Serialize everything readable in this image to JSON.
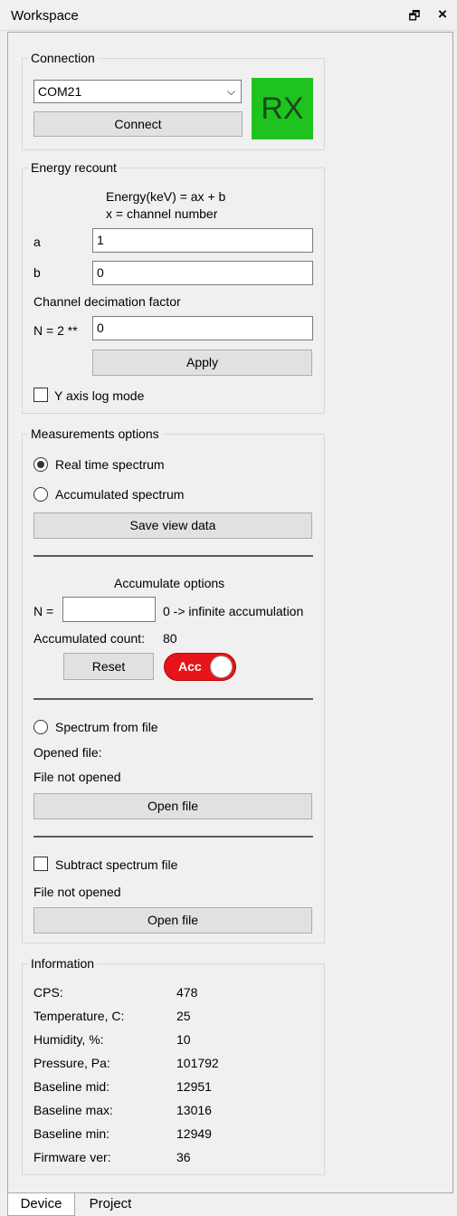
{
  "window": {
    "title": "Workspace",
    "float_icon": "float-window-icon",
    "close_icon": "close-icon"
  },
  "connection": {
    "title": "Connection",
    "port_value": "COM21",
    "connect_label": "Connect",
    "rx_label": "RX",
    "rx_color": "#1ec31e"
  },
  "energy": {
    "title": "Energy recount",
    "formula_line1": "Energy(keV) = ax + b",
    "formula_line2": "x = channel number",
    "a_label": "a",
    "a_value": "1",
    "b_label": "b",
    "b_value": "0",
    "decimation_label": "Channel decimation factor",
    "n_label": "N = 2 **",
    "n_value": "0",
    "apply_label": "Apply",
    "ylog_label": "Y axis log mode",
    "ylog_checked": false
  },
  "measurements": {
    "title": "Measurements options",
    "realtime_label": "Real time spectrum",
    "accumulated_label": "Accumulated spectrum",
    "save_label": "Save view data",
    "acc_options_title": "Accumulate options",
    "n_label": "N =",
    "n_value": "",
    "n_hint": "0 -> infinite accumulation",
    "acc_count_label": "Accumulated count:",
    "acc_count_value": "80",
    "reset_label": "Reset",
    "acc_toggle_label": "Acc",
    "acc_toggle_color": "#e8141b",
    "spectrum_file_label": "Spectrum from file",
    "opened_file_label": "Opened file:",
    "file_status": "File not opened",
    "open_file_label": "Open file",
    "subtract_label": "Subtract spectrum file",
    "subtract_status": "File not opened",
    "open_file2_label": "Open file"
  },
  "information": {
    "title": "Information",
    "rows": [
      {
        "label": "CPS:",
        "value": "478"
      },
      {
        "label": "Temperature, C:",
        "value": "25"
      },
      {
        "label": "Humidity, %:",
        "value": "10"
      },
      {
        "label": "Pressure, Pa:",
        "value": "101792"
      },
      {
        "label": "Baseline mid:",
        "value": "12951"
      },
      {
        "label": "Baseline max:",
        "value": "13016"
      },
      {
        "label": "Baseline min:",
        "value": "12949"
      },
      {
        "label": "Firmware ver:",
        "value": "36"
      }
    ]
  },
  "tabs": [
    {
      "label": "Device",
      "active": true
    },
    {
      "label": "Project",
      "active": false
    }
  ]
}
